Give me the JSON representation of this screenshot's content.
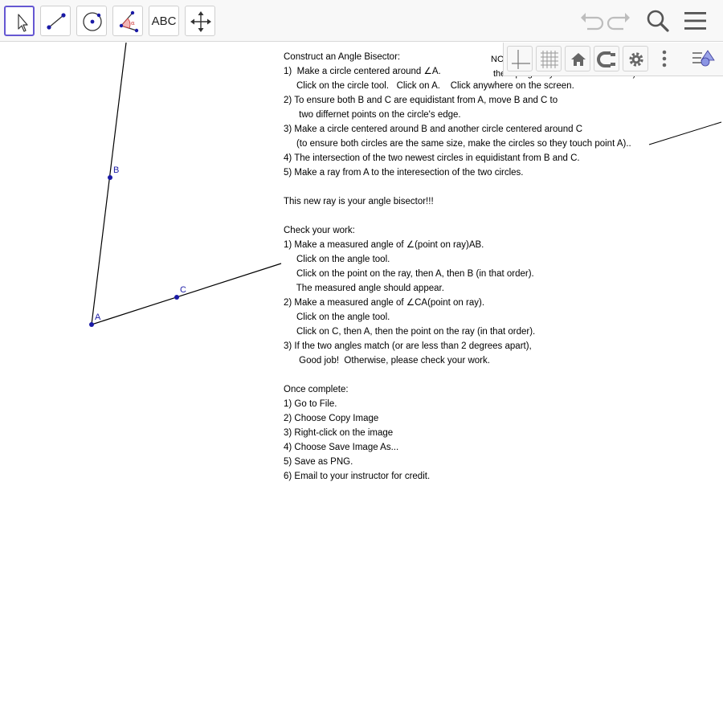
{
  "toolbar": {
    "tools": [
      {
        "name": "Move",
        "icon": "arrow-pointer-icon",
        "selected": true
      },
      {
        "name": "Segment",
        "icon": "segment-icon"
      },
      {
        "name": "Circle with Center through Point",
        "icon": "circle-center-icon"
      },
      {
        "name": "Angle",
        "icon": "angle-icon"
      },
      {
        "name": "Text",
        "icon": "text-icon",
        "label": "ABC"
      },
      {
        "name": "Move Graphics View",
        "icon": "move-view-icon"
      }
    ],
    "right_icons": [
      "undo-icon",
      "redo-icon",
      "search-icon",
      "hamburger-menu-icon"
    ],
    "accent_color": "#6557d2"
  },
  "style_bar": {
    "icons": [
      "axes-icon",
      "grid-icon",
      "home-icon",
      "point-capture-icon",
      "settings-icon",
      "more-vertical-icon",
      "algebra-toggle-icon"
    ]
  },
  "canvas": {
    "point_color": "#1a1aa6",
    "points": [
      {
        "label": "A"
      },
      {
        "label": "B"
      },
      {
        "label": "C"
      }
    ]
  },
  "instructions": {
    "lines": [
      "Construct an Angle Bisector:",
      "1)  Make a circle centered around ∠A.",
      "     Click on the circle tool.   Click on A.    Click anywhere on the screen.",
      "2) To ensure both B and C are equidistant from A, move B and C to",
      "      two differnet points on the circle's edge.",
      "3) Make a circle centered around B and another circle centered around C",
      "     (to ensure both circles are the same size, make the circles so they touch point A)..",
      "4) The intersection of the two newest circles in equidistant from B and C.",
      "5) Make a ray from A to the interesection of the two circles.",
      "",
      "This new ray is your angle bisector!!!",
      "",
      "Check your work:",
      "1) Make a measured angle of ∠(point on ray)AB.",
      "     Click on the angle tool.",
      "     Click on the point on the ray, then A, then B (in that order).",
      "     The measured angle should appear.",
      "2) Make a measured angle of ∠CA(point on ray).",
      "     Click on the angle tool.",
      "     Click on C, then A, then the point on the ray (in that order).",
      "3) If the two angles match (or are less than 2 degrees apart),",
      "      Good job!  Otherwise, please check your work.",
      "",
      "Once complete:",
      "1) Go to File.",
      "2) Choose Copy Image",
      "3) Right-click on the image",
      "4) Choose Save Image As...",
      "5) Save as PNG.",
      "6) Email to your instructor for credit."
    ]
  },
  "partial_note": {
    "line1": "NO",
    "line2": "the top right if you make a mistake :)"
  }
}
